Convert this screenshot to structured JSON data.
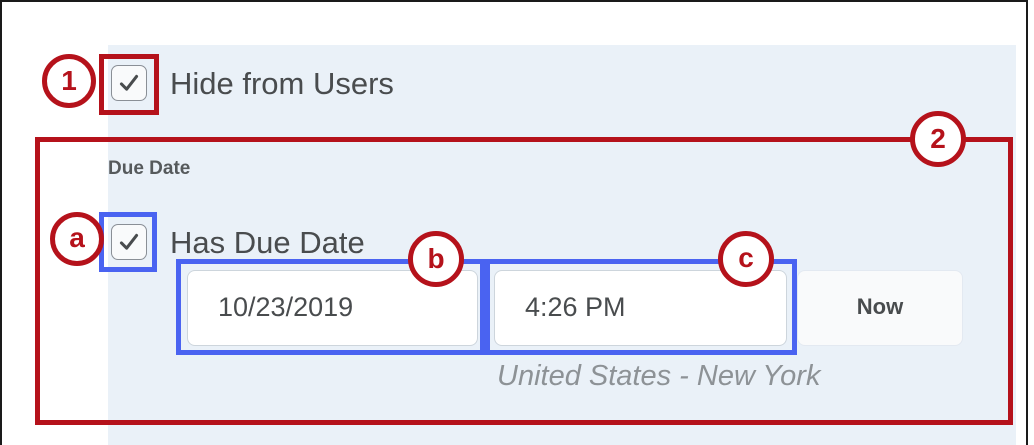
{
  "hide_from_users": {
    "label": "Hide from Users",
    "checked": true
  },
  "due_date": {
    "section_label": "Due Date",
    "has_due_date": {
      "label": "Has Due Date",
      "checked": true
    },
    "date_value": "10/23/2019",
    "time_value": "4:26 PM",
    "now_button": "Now",
    "timezone": "United States - New York"
  },
  "markers": {
    "m1": "1",
    "m2": "2",
    "ma": "a",
    "mb": "b",
    "mc": "c"
  },
  "colors": {
    "annotation_red": "#b5121b",
    "annotation_blue": "#4a63f1",
    "panel_bg": "#eaf1f8"
  },
  "icons": {
    "checkbox_glyph": "check-icon"
  }
}
